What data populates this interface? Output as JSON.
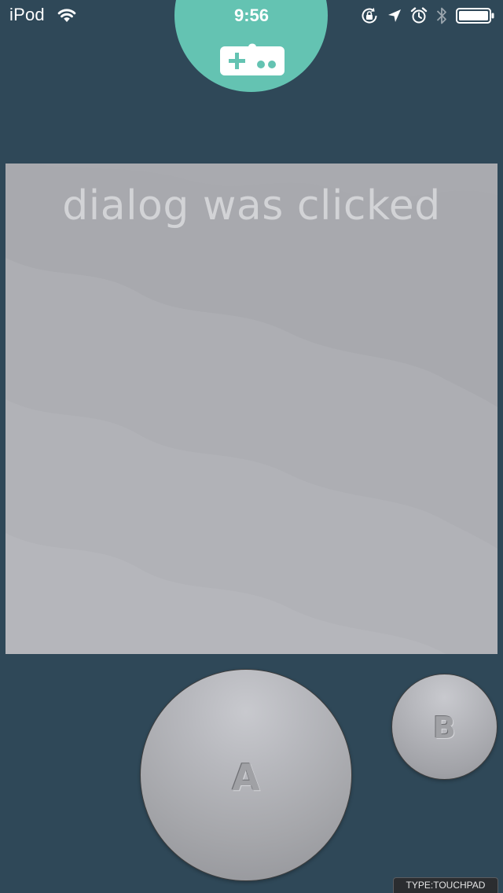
{
  "status_bar": {
    "device_name": "iPod",
    "time": "9:56",
    "icons": [
      "wifi-icon",
      "rotation-lock-icon",
      "location-arrow-icon",
      "alarm-icon",
      "bluetooth-icon",
      "battery-icon"
    ],
    "battery_level": 1.0
  },
  "controller_badge": {
    "icon": "gamepad-icon",
    "color": "#64c3b2"
  },
  "game_screen": {
    "message": "dialog was clicked",
    "background_color": "#b0b1b6"
  },
  "buttons": {
    "a_label": "A",
    "b_label": "B"
  },
  "input_type": {
    "label": "TYPE:TOUCHPAD"
  },
  "colors": {
    "background": "#2f4858",
    "accent": "#64c3b2"
  }
}
